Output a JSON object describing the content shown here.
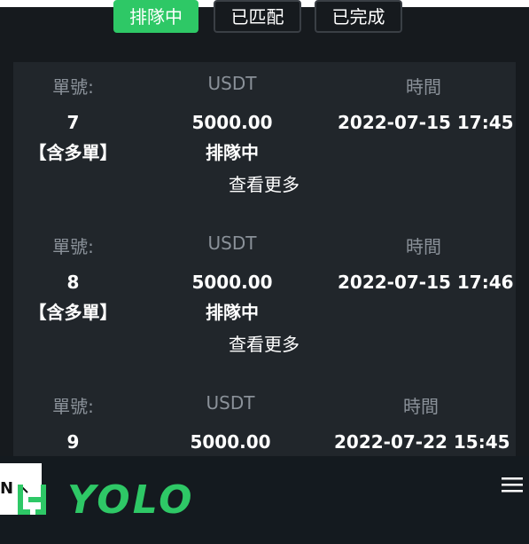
{
  "tabs": [
    {
      "label": "排隊中",
      "active": true
    },
    {
      "label": "已匹配",
      "active": false
    },
    {
      "label": "已完成",
      "active": false
    }
  ],
  "columns": {
    "id": "單號:",
    "amount": "USDT",
    "time": "時間"
  },
  "orders": [
    {
      "id": "7",
      "tag": "【含多單】",
      "amount": "5000.00",
      "status": "排隊中",
      "time": "2022-07-15 17:45",
      "more": "查看更多"
    },
    {
      "id": "8",
      "tag": "【含多單】",
      "amount": "5000.00",
      "status": "排隊中",
      "time": "2022-07-15 17:46",
      "more": "查看更多"
    },
    {
      "id": "9",
      "tag": "",
      "amount": "5000.00",
      "status": "",
      "time": "2022-07-22 15:45",
      "more": ""
    }
  ],
  "footer": {
    "lang_label": "N",
    "logo_text": "YOLO"
  },
  "colors": {
    "accent": "#2ec866",
    "bg": "#161a1e",
    "card": "#21262b",
    "muted": "#8a9199"
  }
}
